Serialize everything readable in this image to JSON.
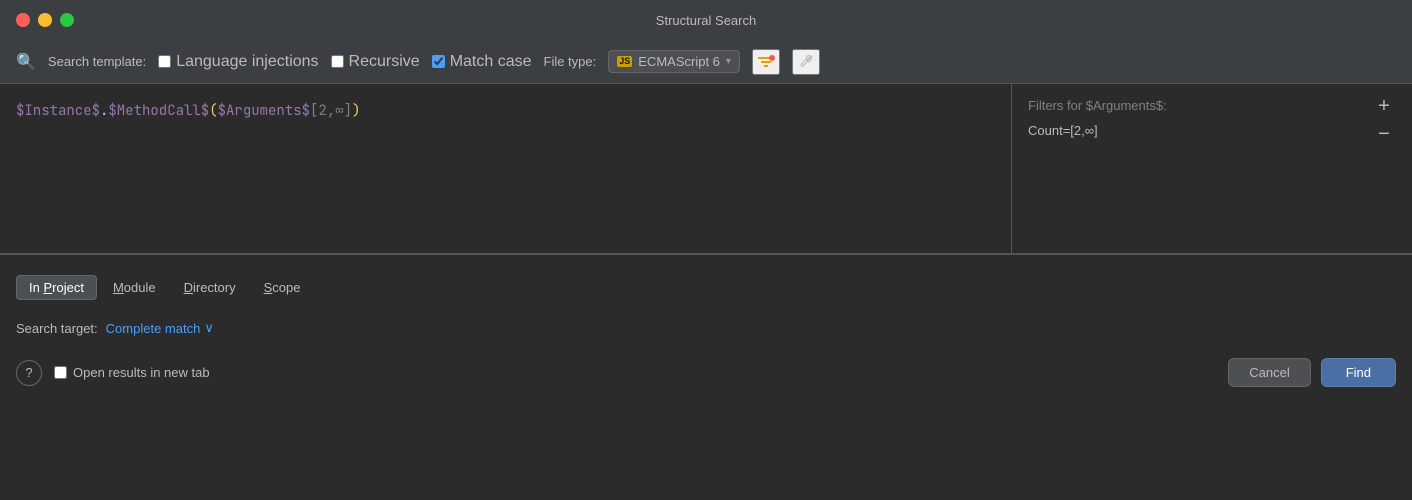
{
  "titleBar": {
    "title": "Structural Search",
    "closeBtn": "●",
    "minimizeBtn": "●",
    "maximizeBtn": "●"
  },
  "toolbar": {
    "searchIcon": "🔍",
    "searchTemplateLabel": "Search template:",
    "languageInjectionsLabel": "Language injections",
    "recursiveLabel": "Recursive",
    "matchCaseLabel": "Match case",
    "fileTypeLabel": "File type:",
    "fileTypeIcon": "JS",
    "fileTypeValue": "ECMAScript 6",
    "languageInjectionsChecked": false,
    "recursiveChecked": false,
    "matchCaseChecked": true
  },
  "codeTemplate": {
    "part1": "$Instance$",
    "dot": ".",
    "part2": "$MethodCall$",
    "part3": "(",
    "part4": "$Arguments$",
    "part5": " [2,∞]",
    "part6": " )"
  },
  "filtersPanel": {
    "title": "Filters for $Arguments$:",
    "countFilter": "Count=[2,∞]",
    "addBtnLabel": "+",
    "minusBtnLabel": "−"
  },
  "scopeTabs": [
    {
      "id": "in-project",
      "label": "In Project",
      "underlineIndex": 3,
      "active": true
    },
    {
      "id": "module",
      "label": "Module",
      "underlineIndex": 0,
      "active": false
    },
    {
      "id": "directory",
      "label": "Directory",
      "underlineIndex": 0,
      "active": false
    },
    {
      "id": "scope",
      "label": "Scope",
      "underlineIndex": 0,
      "active": false
    }
  ],
  "searchTarget": {
    "label": "Search target:",
    "value": "Complete match",
    "chevron": "∨"
  },
  "bottomBar": {
    "helpBtnLabel": "?",
    "openInNewTabLabel": "Open results in new tab",
    "openInNewTabChecked": false,
    "cancelBtnLabel": "Cancel",
    "findBtnLabel": "Find"
  }
}
